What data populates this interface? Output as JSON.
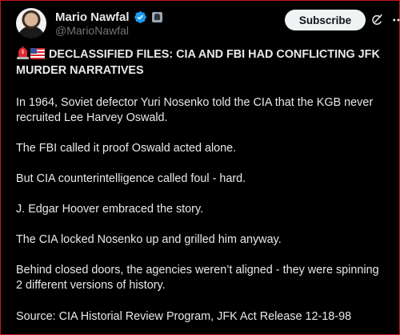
{
  "post": {
    "author": {
      "display_name": "Mario Nawfal",
      "handle": "@MarioNawfal",
      "verified_icon": "verified-badge-icon",
      "affiliate_icon": "affiliate-badge-icon"
    },
    "subscribe_label": "Subscribe",
    "title": "DECLASSIFIED FILES: CIA AND FBI HAD CONFLICTING JFK MURDER NARRATIVES",
    "title_lines": [
      "DECLASSIFIED FILES: CIA AND FBI HAD CONFLICTING JFK",
      "MURDER NARRATIVES"
    ],
    "title_emojis": [
      "siren-icon",
      "us-flag-icon"
    ],
    "paragraphs": [
      {
        "lines": [
          "In 1964, Soviet defector Yuri Nosenko told the CIA that the KGB never",
          "recruited Lee Harvey Oswald."
        ]
      },
      {
        "lines": [
          "The FBI called it proof Oswald acted alone."
        ]
      },
      {
        "lines": [
          "But CIA counterintelligence called foul - hard."
        ]
      },
      {
        "lines": [
          "J. Edgar Hoover embraced the story."
        ]
      },
      {
        "lines": [
          "The CIA locked Nosenko up and grilled him anyway."
        ]
      },
      {
        "lines": [
          "Behind closed doors, the agencies weren’t aligned - they were spinning",
          "2 different versions of history."
        ]
      },
      {
        "lines": [
          "Source: CIA Historial Review Program, JFK Act Release 12-18-98"
        ]
      }
    ]
  },
  "colors": {
    "background": "#000000",
    "text": "#e7e9ea",
    "muted": "#71767b",
    "verified": "#1d9bf0",
    "button_bg": "#eff3f4",
    "button_text": "#0f1419",
    "frame_border": "#c4161c"
  }
}
